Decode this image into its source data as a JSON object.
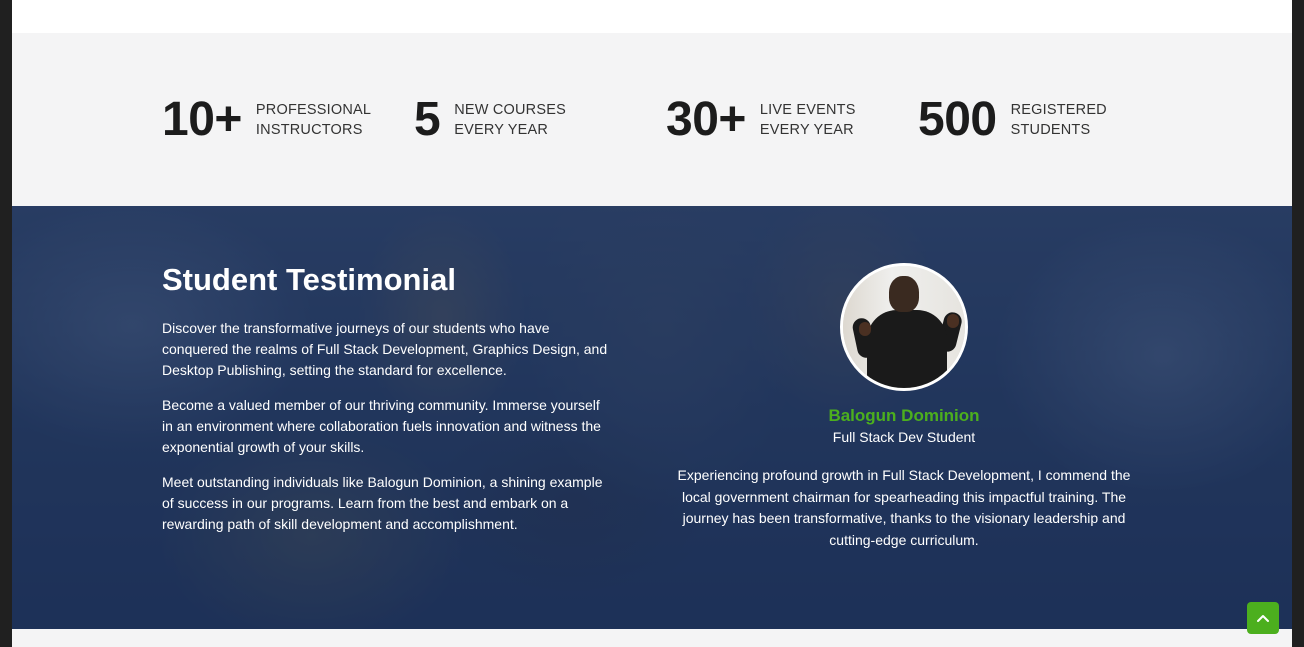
{
  "stats": [
    {
      "number": "10+",
      "line1": "PROFESSIONAL",
      "line2": "INSTRUCTORS"
    },
    {
      "number": "5",
      "line1": "NEW COURSES",
      "line2": "EVERY YEAR"
    },
    {
      "number": "30+",
      "line1": "LIVE EVENTS",
      "line2": "EVERY YEAR"
    },
    {
      "number": "500",
      "line1": "REGISTERED",
      "line2": "STUDENTS"
    }
  ],
  "testimonial": {
    "title": "Student Testimonial",
    "paragraphs": [
      "Discover the transformative journeys of our students who have conquered the realms of Full Stack Development, Graphics Design, and Desktop Publishing, setting the standard for excellence.",
      "Become a valued member of our thriving community. Immerse yourself in an environment where collaboration fuels innovation and witness the exponential growth of your skills.",
      "Meet outstanding individuals like Balogun Dominion, a shining example of success in our programs. Learn from the best and embark on a rewarding path of skill development and accomplishment."
    ],
    "student": {
      "name": "Balogun Dominion",
      "role": "Full Stack Dev Student",
      "quote": "Experiencing profound growth in Full Stack Development, I commend the local government chairman for spearheading this impactful training. The journey has been transformative, thanks to the visionary leadership and cutting-edge curriculum."
    }
  },
  "icons": {
    "scroll_top": "chevron-up-icon"
  },
  "colors": {
    "accent_green": "#4caf1e",
    "overlay_navy": "#1a2d55",
    "stats_bg": "#f4f4f5"
  }
}
